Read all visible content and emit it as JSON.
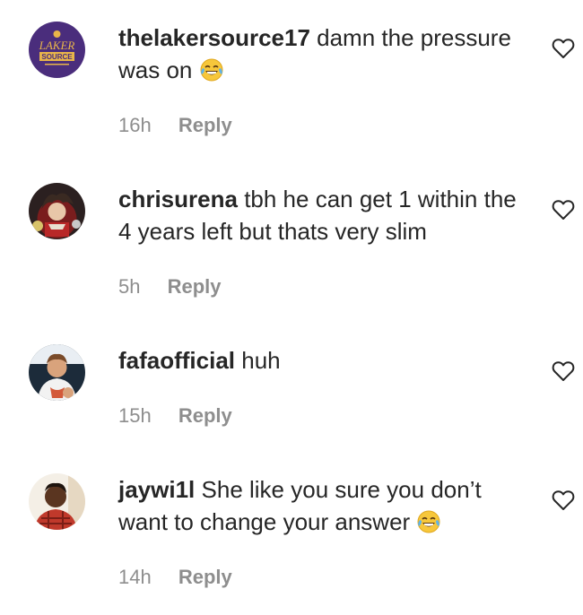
{
  "colors": {
    "text": "#262626",
    "muted": "#8e8e8e",
    "background": "#ffffff"
  },
  "comments": [
    {
      "username": "thelakersource17",
      "text": "damn the pressure was on",
      "emoji": "face-with-tears-of-joy",
      "time": "16h",
      "reply_label": "Reply",
      "avatar_text_top": "LAKER",
      "avatar_text_bottom": "SOURCE",
      "like_icon": "heart-outline-icon"
    },
    {
      "username": "chrisurena",
      "text": "tbh he can get 1 within the 4 years left but thats very slim",
      "time": "5h",
      "reply_label": "Reply",
      "like_icon": "heart-outline-icon"
    },
    {
      "username": "fafaofficial",
      "text": "huh",
      "time": "15h",
      "reply_label": "Reply",
      "like_icon": "heart-outline-icon"
    },
    {
      "username": "jaywi1l",
      "text": "She like you sure you don’t want to change your answer",
      "emoji": "face-with-tears-of-joy",
      "time": "14h",
      "reply_label": "Reply",
      "like_icon": "heart-outline-icon"
    }
  ]
}
